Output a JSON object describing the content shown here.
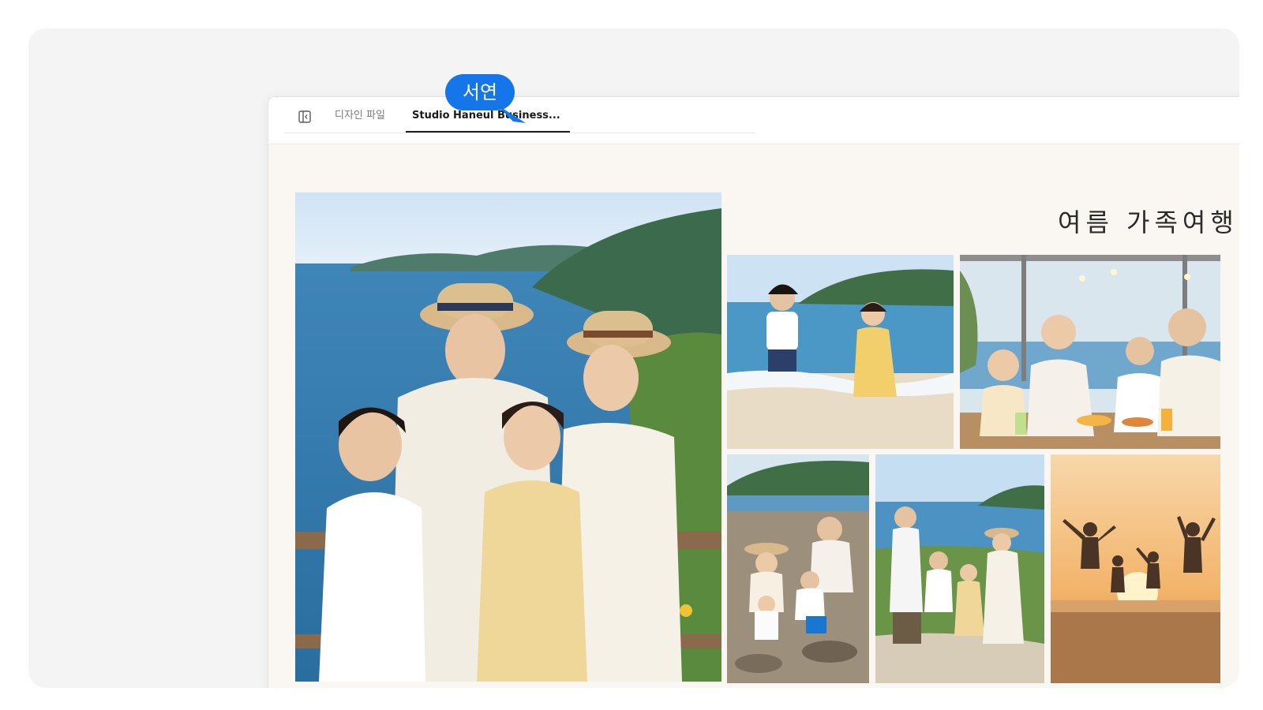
{
  "tabs": [
    {
      "label": "디자인 파일",
      "active": false
    },
    {
      "label": "Studio Haneul Business...",
      "active": true
    }
  ],
  "document": {
    "title": "여름 가족여행"
  },
  "collaborator": {
    "name": "서연",
    "color": "#1476e8"
  },
  "icons": {
    "sidebar_toggle": "sidebar-toggle-icon"
  },
  "colors": {
    "canvas_bg": "#faf7f2",
    "stage_bg": "#f4f4f4",
    "cursor": "#1476e8"
  }
}
